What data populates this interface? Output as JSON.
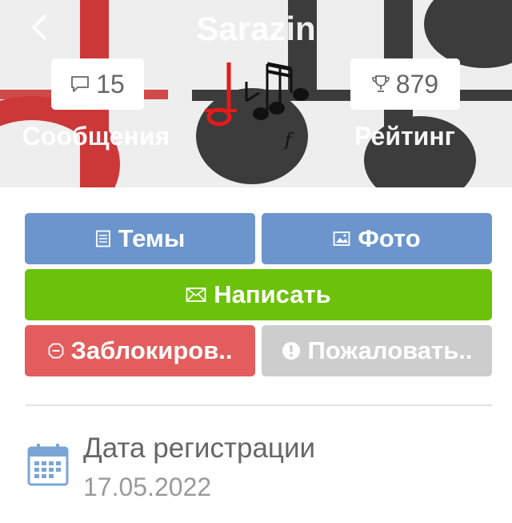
{
  "header": {
    "title": "Sarazin",
    "back_icon": "chevron-left-icon",
    "messages": {
      "count": "15",
      "label": "Сообщения",
      "icon": "comment-icon"
    },
    "rating": {
      "count": "879",
      "label": "Рейтинг",
      "icon": "trophy-icon"
    }
  },
  "actions": {
    "topics": "Темы",
    "photos": "Фото",
    "write": "Написать",
    "block": "Заблокиров..",
    "report": "Пожаловать.."
  },
  "info": {
    "registration_label": "Дата регистрации",
    "registration_date": "17.05.2022",
    "icon": "calendar-icon"
  },
  "colors": {
    "blue_button": "#6b95cc",
    "green_button": "#6cc10a",
    "red_button": "#e35d5d",
    "gray_button": "#cdcdcd"
  }
}
